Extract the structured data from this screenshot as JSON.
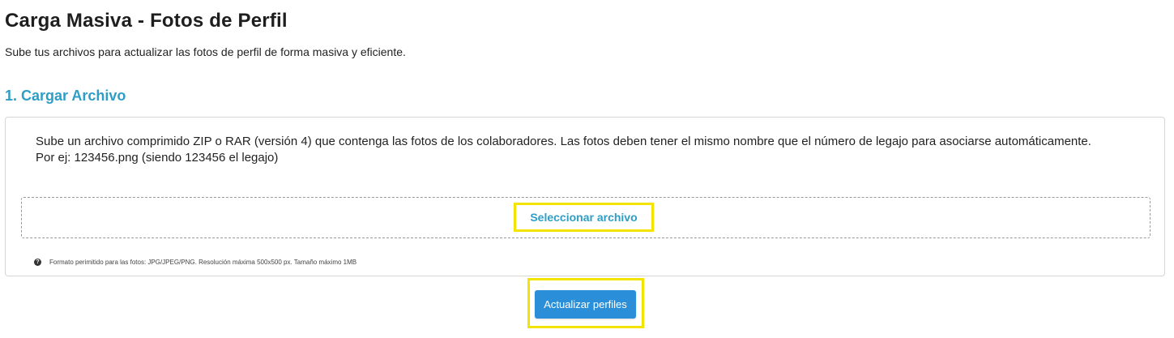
{
  "header": {
    "title": "Carga Masiva - Fotos de Perfil",
    "subtitle": "Sube tus archivos para actualizar las fotos de perfil de forma masiva y eficiente."
  },
  "section": {
    "title": "1. Cargar Archivo"
  },
  "upload": {
    "description_line1": "Sube un archivo comprimido ZIP o RAR (versión 4) que contenga las fotos de los colaboradores. Las fotos deben tener el mismo nombre que el número de legajo para asociarse automáticamente.",
    "description_line2": "Por ej: 123456.png (siendo 123456 el legajo)",
    "select_label": "Seleccionar archivo",
    "hint_icon": "question-circle-icon",
    "hint_text": "Formato perimitido para las fotos: JPG/JPEG/PNG. Resolución máxima 500x500 px. Tamaño máximo 1MB"
  },
  "actions": {
    "update_label": "Actualizar perfiles"
  },
  "colors": {
    "accent": "#2e9ec6",
    "button": "#2a8fd8",
    "highlight": "#f2e300"
  }
}
